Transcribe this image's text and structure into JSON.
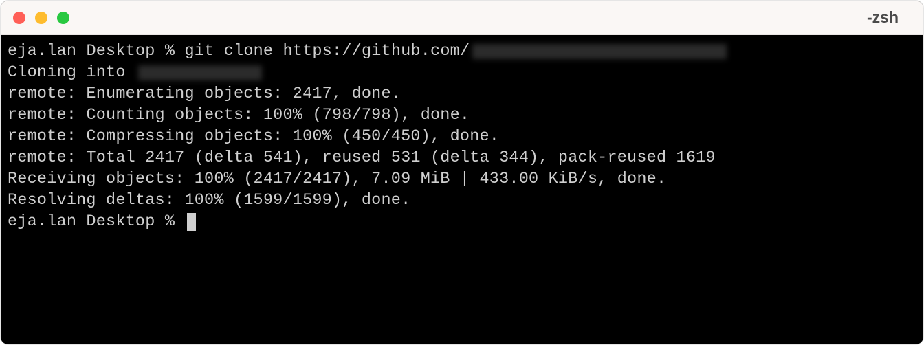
{
  "window": {
    "title": "-zsh"
  },
  "terminal": {
    "prompt_user_host": "eja.lan",
    "prompt_dir": "Desktop",
    "prompt_symbol": "%",
    "command": "git clone https://github.com/",
    "lines": {
      "cloning_into": "Cloning into ",
      "enumerating": "remote: Enumerating objects: 2417, done.",
      "counting": "remote: Counting objects: 100% (798/798), done.",
      "compressing": "remote: Compressing objects: 100% (450/450), done.",
      "total": "remote: Total 2417 (delta 541), reused 531 (delta 344), pack-reused 1619",
      "receiving": "Receiving objects: 100% (2417/2417), 7.09 MiB | 433.00 KiB/s, done.",
      "resolving": "Resolving deltas: 100% (1599/1599), done."
    },
    "prompt2": "eja.lan Desktop % "
  },
  "colors": {
    "bg": "#000000",
    "fg": "#cfcfcf",
    "titlebar": "#faf7f5",
    "red": "#ff5f57",
    "yellow": "#febc2e",
    "green": "#28c840"
  }
}
